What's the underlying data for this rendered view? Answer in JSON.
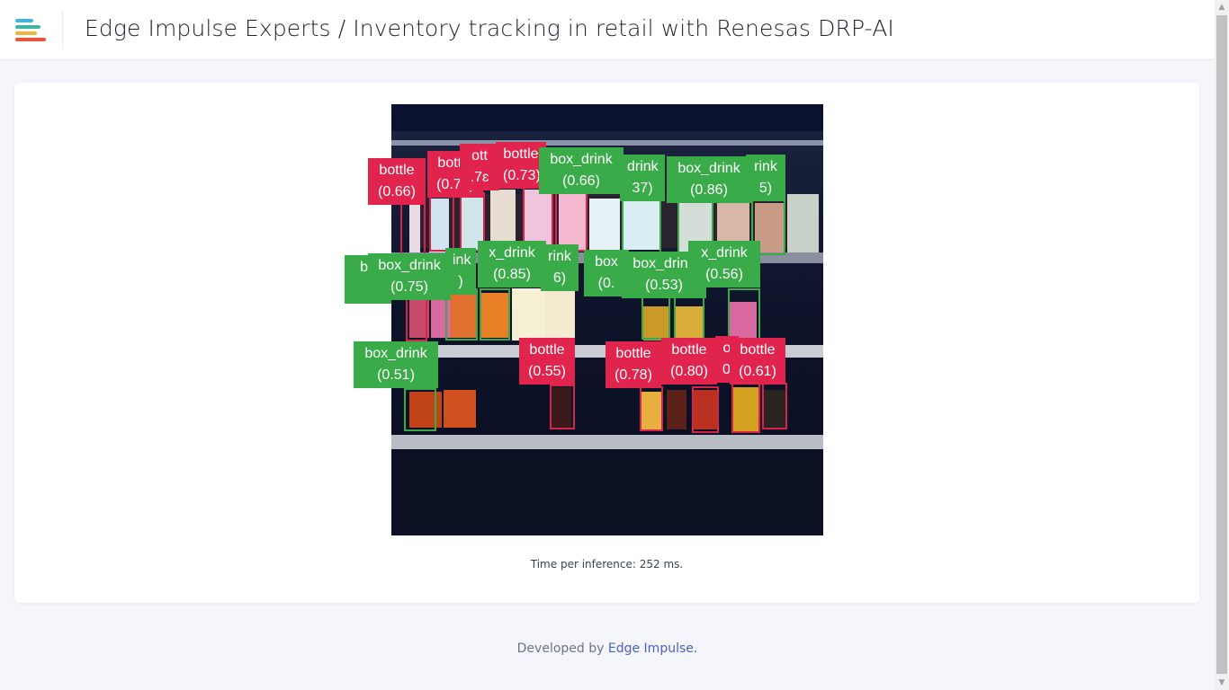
{
  "header": {
    "title": "Edge Impulse Experts / Inventory tracking in retail with Renesas DRP-AI",
    "logo_icon": "edge-impulse-logo-icon"
  },
  "colors": {
    "bottle": "#e0244e",
    "box_drink": "#3aab49",
    "link": "#4a5ec4"
  },
  "detections": [
    {
      "label": "bottle",
      "conf": "(0.66)",
      "kind": "red"
    },
    {
      "label": "bottle",
      "conf": "(0.70)",
      "kind": "red"
    },
    {
      "label": "ott",
      "conf": ".7ɛ",
      "kind": "red"
    },
    {
      "label": "bottle",
      "conf": "(0.73)",
      "kind": "red"
    },
    {
      "label": "box_drink",
      "conf": "(0.66)",
      "kind": "green"
    },
    {
      "label": "drink",
      "conf": "37)",
      "kind": "green"
    },
    {
      "label": "box_drink",
      "conf": "(0.86)",
      "kind": "green"
    },
    {
      "label": "rink",
      "conf": "5)",
      "kind": "green"
    },
    {
      "label": "bo",
      "conf": "",
      "kind": "green"
    },
    {
      "label": "box_drink",
      "conf": "(0.75)",
      "kind": "green"
    },
    {
      "label": "ink",
      "conf": ")",
      "kind": "green"
    },
    {
      "label": "x_drink",
      "conf": "(0.85)",
      "kind": "green"
    },
    {
      "label": "rink",
      "conf": "6)",
      "kind": "green"
    },
    {
      "label": "box",
      "conf": "(0.",
      "kind": "green"
    },
    {
      "label": "box_drink",
      "conf": "(0.53)",
      "kind": "green"
    },
    {
      "label": "x_drink",
      "conf": "(0.56)",
      "kind": "green"
    },
    {
      "label": "box_drink",
      "conf": "(0.51)",
      "kind": "green"
    },
    {
      "label": "bottle",
      "conf": "(0.55)",
      "kind": "red"
    },
    {
      "label": "bottle",
      "conf": "(0.78)",
      "kind": "red"
    },
    {
      "label": "bottle",
      "conf": "(0.80)",
      "kind": "red"
    },
    {
      "label": "o",
      "conf": "0.",
      "kind": "red"
    },
    {
      "label": "bottle",
      "conf": "(0.61)",
      "kind": "red"
    }
  ],
  "inference": {
    "text": "Time per inference: 252 ms."
  },
  "footer": {
    "prefix": "Developed by ",
    "link_text": "Edge Impulse."
  }
}
